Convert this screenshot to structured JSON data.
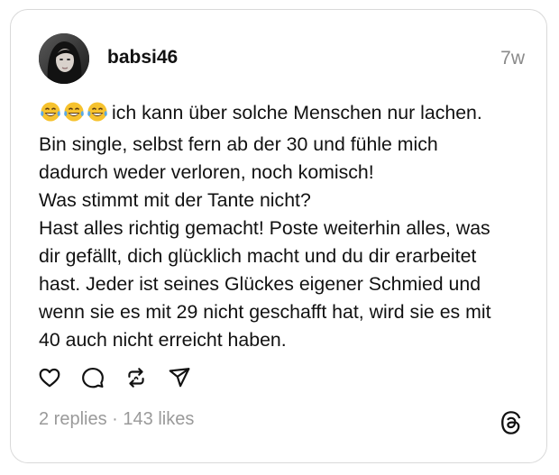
{
  "post": {
    "author": {
      "username": "babsi46"
    },
    "time_ago": "7w",
    "lines": [
      "ich kann über solche Menschen nur lachen.",
      "Bin single, selbst fern ab der 30 und fühle mich",
      "dadurch weder verloren, noch komisch!",
      "Was stimmt mit der Tante nicht?",
      "Hast alles richtig gemacht! Poste weiterhin alles, was",
      "dir gefällt, dich glücklich macht und du dir erarbeitet",
      "hast. Jeder ist seines Glückes eigener Schmied und",
      "wenn sie es mit 29 nicht geschafft hat, wird sie es mit",
      "40 auch nicht erreicht haben."
    ],
    "leading_emoji": [
      "face-with-tears-of-joy",
      "face-with-tears-of-joy",
      "face-with-tears-of-joy"
    ],
    "actions": [
      "heart-icon",
      "comment-icon",
      "repost-icon",
      "share-icon"
    ],
    "stats": {
      "replies": "2 replies",
      "separator": " · ",
      "likes": "143 likes"
    },
    "brand_icon": "threads-logo-icon"
  },
  "colors": {
    "text": "#111111",
    "muted": "#8a8a8a",
    "border": "#d9d9d9",
    "emoji_face": "#f6c22e"
  }
}
